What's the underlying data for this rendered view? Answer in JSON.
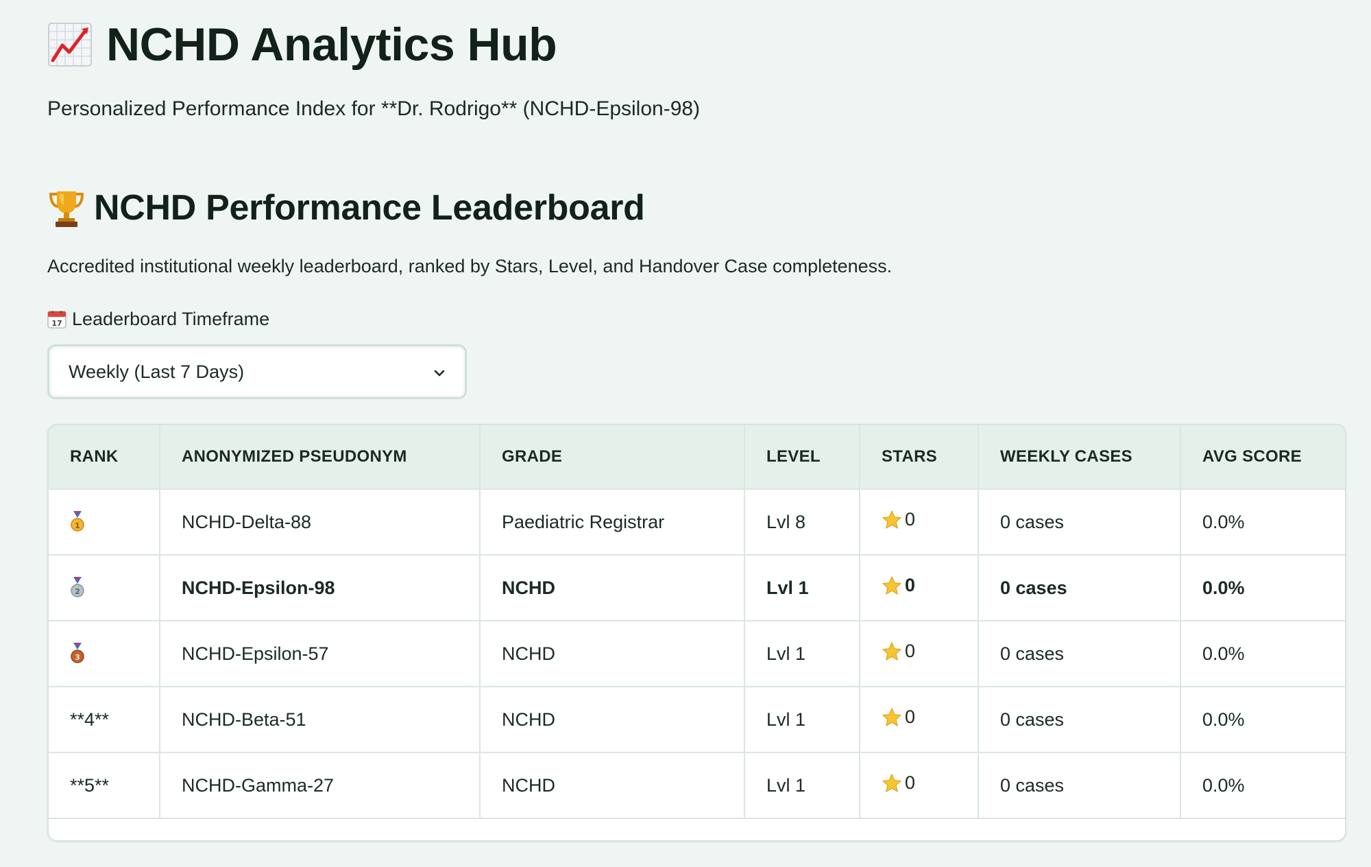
{
  "header": {
    "title": "NCHD Analytics Hub",
    "title_icon": "chart-increasing-icon",
    "subtitle": "Personalized Performance Index for **Dr. Rodrigo** (NCHD-Epsilon-98)"
  },
  "leaderboard": {
    "title": "NCHD Performance Leaderboard",
    "title_icon": "trophy-icon",
    "description": "Accredited institutional weekly leaderboard, ranked by Stars, Level, and Handover Case completeness.",
    "timeframe_label": "Leaderboard Timeframe",
    "timeframe_icon": "calendar-icon",
    "timeframe_value": "Weekly (Last 7 Days)",
    "columns": [
      "RANK",
      "ANONYMIZED PSEUDONYM",
      "GRADE",
      "LEVEL",
      "STARS",
      "WEEKLY CASES",
      "AVG SCORE"
    ],
    "rows": [
      {
        "rank": "",
        "rank_icon": "gold-medal-icon",
        "pseudonym": "NCHD-Delta-88",
        "grade": "Paediatric Registrar",
        "level": "Lvl 8",
        "stars": "0",
        "cases": "0 cases",
        "avg": "0.0%",
        "highlight": false
      },
      {
        "rank": "",
        "rank_icon": "silver-medal-icon",
        "pseudonym": "NCHD-Epsilon-98",
        "grade": "NCHD",
        "level": "Lvl 1",
        "stars": "0",
        "cases": "0 cases",
        "avg": "0.0%",
        "highlight": true
      },
      {
        "rank": "",
        "rank_icon": "bronze-medal-icon",
        "pseudonym": "NCHD-Epsilon-57",
        "grade": "NCHD",
        "level": "Lvl 1",
        "stars": "0",
        "cases": "0 cases",
        "avg": "0.0%",
        "highlight": false
      },
      {
        "rank": "**4**",
        "rank_icon": "",
        "pseudonym": "NCHD-Beta-51",
        "grade": "NCHD",
        "level": "Lvl 1",
        "stars": "0",
        "cases": "0 cases",
        "avg": "0.0%",
        "highlight": false
      },
      {
        "rank": "**5**",
        "rank_icon": "",
        "pseudonym": "NCHD-Gamma-27",
        "grade": "NCHD",
        "level": "Lvl 1",
        "stars": "0",
        "cases": "0 cases",
        "avg": "0.0%",
        "highlight": false
      }
    ]
  },
  "colors": {
    "background": "#eff5f2",
    "header_row": "#e6f0eb",
    "text": "#12211a",
    "gold": "#f2b632",
    "silver": "#9aa4ad",
    "bronze": "#b5582b",
    "star": "#f7c531"
  }
}
